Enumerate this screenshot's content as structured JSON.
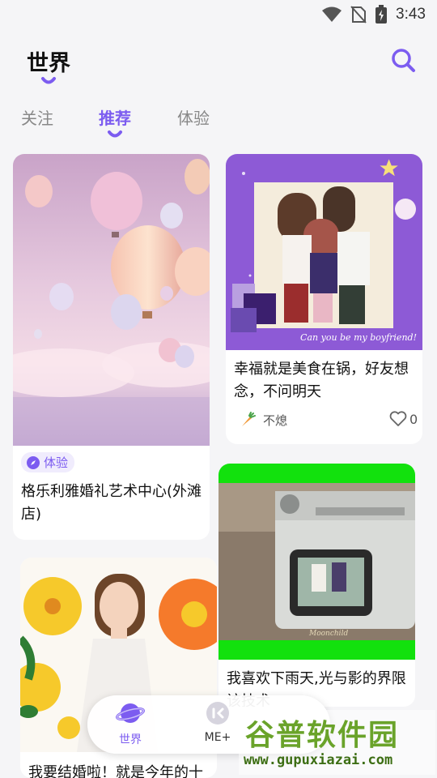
{
  "status": {
    "time": "3:43"
  },
  "header": {
    "title": "世界"
  },
  "tabs": [
    {
      "label": "关注"
    },
    {
      "label": "推荐"
    },
    {
      "label": "体验"
    }
  ],
  "cards": [
    {
      "badge": "体验",
      "title_lines": [
        "格乐利雅婚礼艺术中心(外滩",
        "店)"
      ]
    },
    {
      "title_lines": [
        "幸福就是美食在锅，好友想",
        "念，不问明天"
      ],
      "author": "不熄",
      "likes": "0",
      "image_caption": "Can you be my boyfriend!"
    },
    {
      "title_lines": [
        "我喜欢下雨天,光与影的界限",
        "该技术"
      ],
      "image_caption": "Moonchild"
    },
    {
      "title_lines": [
        "我要结婚啦！就是今年的十"
      ]
    }
  ],
  "nav": [
    {
      "label": "世界"
    },
    {
      "label": "ME+"
    }
  ],
  "watermark": {
    "text": "谷普软件园",
    "url": "www.gupuxiazai.com"
  },
  "colors": {
    "accent": "#7c5cf0",
    "background": "#f5f5f7",
    "green": "#12e10d"
  }
}
